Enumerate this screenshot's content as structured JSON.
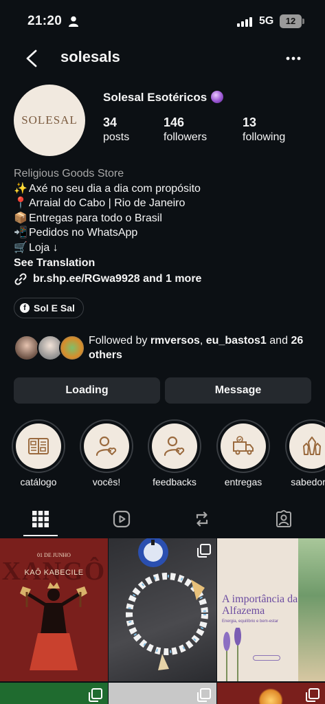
{
  "status_bar": {
    "time": "21:20",
    "network": "5G",
    "battery": "12"
  },
  "header": {
    "username": "solesals"
  },
  "profile": {
    "avatar_logo_text": "SOLESAL",
    "display_name": "Solesal Esotéricos",
    "stats": [
      {
        "value": "34",
        "label": "posts"
      },
      {
        "value": "146",
        "label": "followers"
      },
      {
        "value": "13",
        "label": "following"
      }
    ]
  },
  "bio": {
    "category": "Religious Goods Store",
    "lines": [
      {
        "emoji": "✨",
        "text": "Axé no seu dia a dia com propósito"
      },
      {
        "emoji": "📍",
        "text": "Arraial do Cabo | Rio de Janeiro"
      },
      {
        "emoji": "📦",
        "text": "Entregas para todo o Brasil"
      },
      {
        "emoji": "📲",
        "text": "Pedidos no WhatsApp"
      },
      {
        "emoji": "🛒",
        "text": "Loja ↓"
      }
    ],
    "see_translation": "See Translation",
    "link": "br.shp.ee/RGwa9928 and 1 more"
  },
  "facebook_chip": {
    "label": "Sol E Sal"
  },
  "followed_by": {
    "prefix": "Followed by",
    "user1": "rmversos",
    "sep": ",",
    "user2": "eu_bastos1",
    "and": "and",
    "others": "26 others"
  },
  "actions": {
    "primary": "Loading",
    "secondary": "Message"
  },
  "highlights": [
    {
      "label": "catálogo",
      "icon": "catalog-icon"
    },
    {
      "label": "vocês!",
      "icon": "person-heart-icon"
    },
    {
      "label": "feedbacks",
      "icon": "person-heart-icon"
    },
    {
      "label": "entregas",
      "icon": "delivery-truck-icon"
    },
    {
      "label": "sabedoria",
      "icon": "crystals-icon"
    }
  ],
  "tabs": [
    "grid-icon",
    "reels-icon",
    "reposts-icon",
    "tagged-icon"
  ],
  "posts": {
    "p1": {
      "date": "01 DE JUNHO",
      "title": "XANGÔ",
      "subtitle": "KAÔ KABECILE"
    },
    "p3": {
      "title": "A importância da Alfazema",
      "subtitle": "Energia, equilíbrio e bem-estar"
    }
  },
  "colors": {
    "background": "#0c1014",
    "button": "#25292e",
    "highlight_bg": "#f1e9df",
    "highlight_icon": "#9a6a3e"
  }
}
